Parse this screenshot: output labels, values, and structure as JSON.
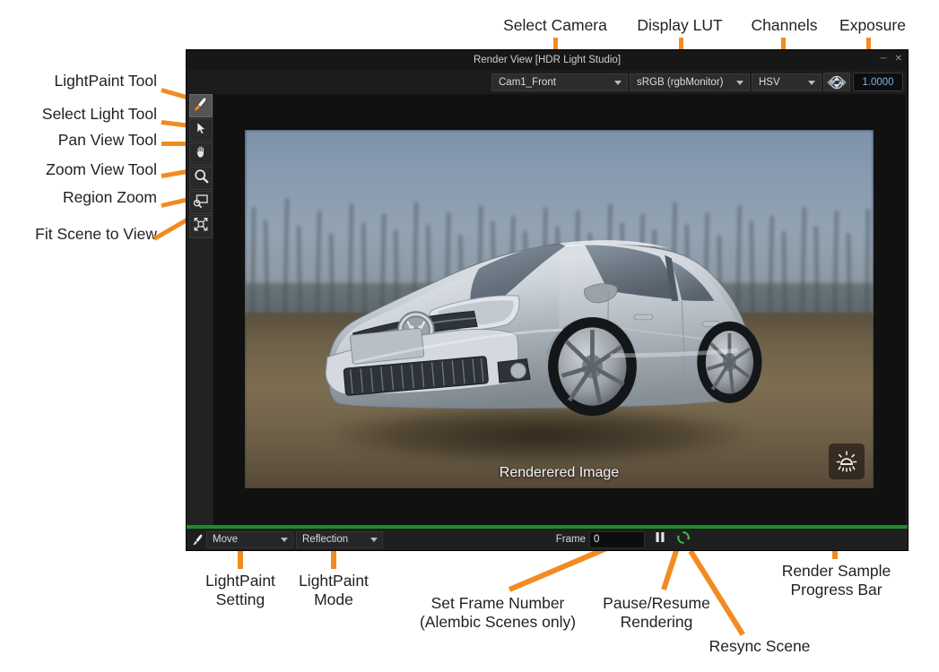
{
  "app": {
    "title": "Render View [HDR Light Studio]",
    "window_buttons": [
      "minimize",
      "close"
    ]
  },
  "options_bar": {
    "camera": {
      "value": "Cam1_Front",
      "icon": "chevron-down-icon"
    },
    "display_lut": {
      "value": "sRGB (rgbMonitor)",
      "icon": "chevron-down-icon"
    },
    "channels": {
      "value": "HSV",
      "icon": "chevron-down-icon"
    },
    "aperture_icon": "aperture-icon",
    "exposure": {
      "value": "1.0000",
      "color": "#7fb4e8"
    }
  },
  "toolbar": {
    "tools": [
      {
        "name": "lightpaint-tool",
        "icon": "brush-icon",
        "active": true
      },
      {
        "name": "select-light-tool",
        "icon": "cursor-arrow-icon",
        "active": false
      },
      {
        "name": "pan-view-tool",
        "icon": "hand-icon",
        "active": false
      },
      {
        "name": "zoom-view-tool",
        "icon": "magnifier-icon",
        "active": false
      },
      {
        "name": "region-zoom-tool",
        "icon": "region-zoom-icon",
        "active": false
      },
      {
        "name": "fit-scene-to-view-tool",
        "icon": "fit-scene-icon",
        "active": false
      }
    ]
  },
  "viewport": {
    "caption": "Renderered Image",
    "hdr_badge_icon": "sun-icon"
  },
  "progress": {
    "percent": 100,
    "color": "#1e8b2b"
  },
  "status_bar": {
    "brush_icon": "brush-icon",
    "lightpaint_setting": {
      "value": "Move",
      "icon": "chevron-down-icon"
    },
    "lightpaint_mode": {
      "value": "Reflection",
      "icon": "chevron-down-icon"
    },
    "frame_label": "Frame",
    "frame_value": "0",
    "pause_icon": "pause-icon",
    "resync_icon": "resync-circular-arrows-icon"
  },
  "annotations": {
    "accent_color": "#F28B21",
    "top": [
      {
        "key": "select-camera",
        "text": "Select Camera"
      },
      {
        "key": "display-lut",
        "text": "Display LUT"
      },
      {
        "key": "channels",
        "text": "Channels"
      },
      {
        "key": "exposure",
        "text": "Exposure"
      }
    ],
    "left": [
      {
        "key": "lightpaint-tool",
        "text": "LightPaint Tool"
      },
      {
        "key": "select-light-tool",
        "text": "Select Light Tool"
      },
      {
        "key": "pan-view-tool",
        "text": "Pan View Tool"
      },
      {
        "key": "zoom-view-tool",
        "text": "Zoom View Tool"
      },
      {
        "key": "region-zoom",
        "text": "Region Zoom"
      },
      {
        "key": "fit-scene-to-view",
        "text": "Fit Scene to View"
      }
    ],
    "bottom": [
      {
        "key": "lightpaint-setting",
        "line1": "LightPaint",
        "line2": "Setting"
      },
      {
        "key": "lightpaint-mode",
        "line1": "LightPaint",
        "line2": "Mode"
      },
      {
        "key": "set-frame-number",
        "line1": "Set Frame Number",
        "line2": "(Alembic Scenes only)"
      },
      {
        "key": "pause-resume-rendering",
        "line1": "Pause/Resume",
        "line2": "Rendering"
      },
      {
        "key": "resync-scene",
        "line1": "Resync Scene",
        "line2": ""
      },
      {
        "key": "render-sample-progress-bar",
        "line1": "Render Sample",
        "line2": "Progress Bar"
      }
    ]
  }
}
